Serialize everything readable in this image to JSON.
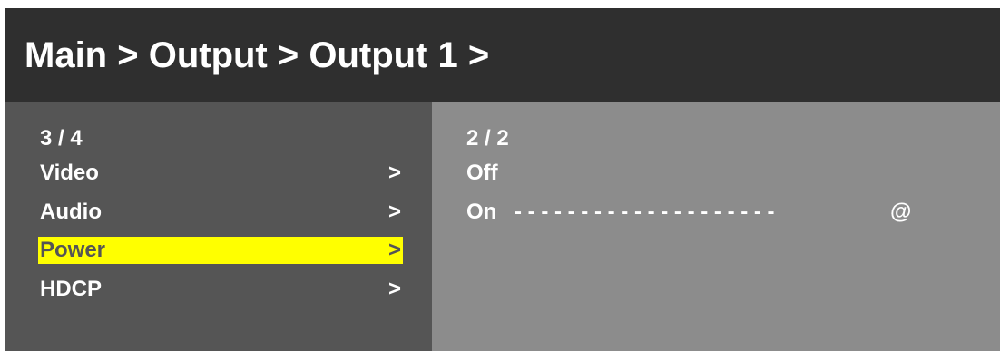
{
  "header": {
    "breadcrumb": "Main > Output > Output 1 >"
  },
  "left_panel": {
    "page_indicator": "3 / 4",
    "items": [
      {
        "label": "Video",
        "arrow": ">",
        "selected": false
      },
      {
        "label": "Audio",
        "arrow": ">",
        "selected": false
      },
      {
        "label": "Power",
        "arrow": ">",
        "selected": true
      },
      {
        "label": "HDCP",
        "arrow": ">",
        "selected": false
      }
    ]
  },
  "right_panel": {
    "page_indicator": "2 / 2",
    "options": [
      {
        "label": "Off",
        "leader": "",
        "marker": ""
      },
      {
        "label": "On",
        "leader": "- - - - - - - - - - - - - - - - - - - -",
        "marker": "@"
      }
    ]
  },
  "colors": {
    "header_bg": "#2f2f2f",
    "left_panel_bg": "#555555",
    "right_panel_bg": "#8c8c8c",
    "highlight": "#ffff00",
    "text": "#ffffff"
  }
}
